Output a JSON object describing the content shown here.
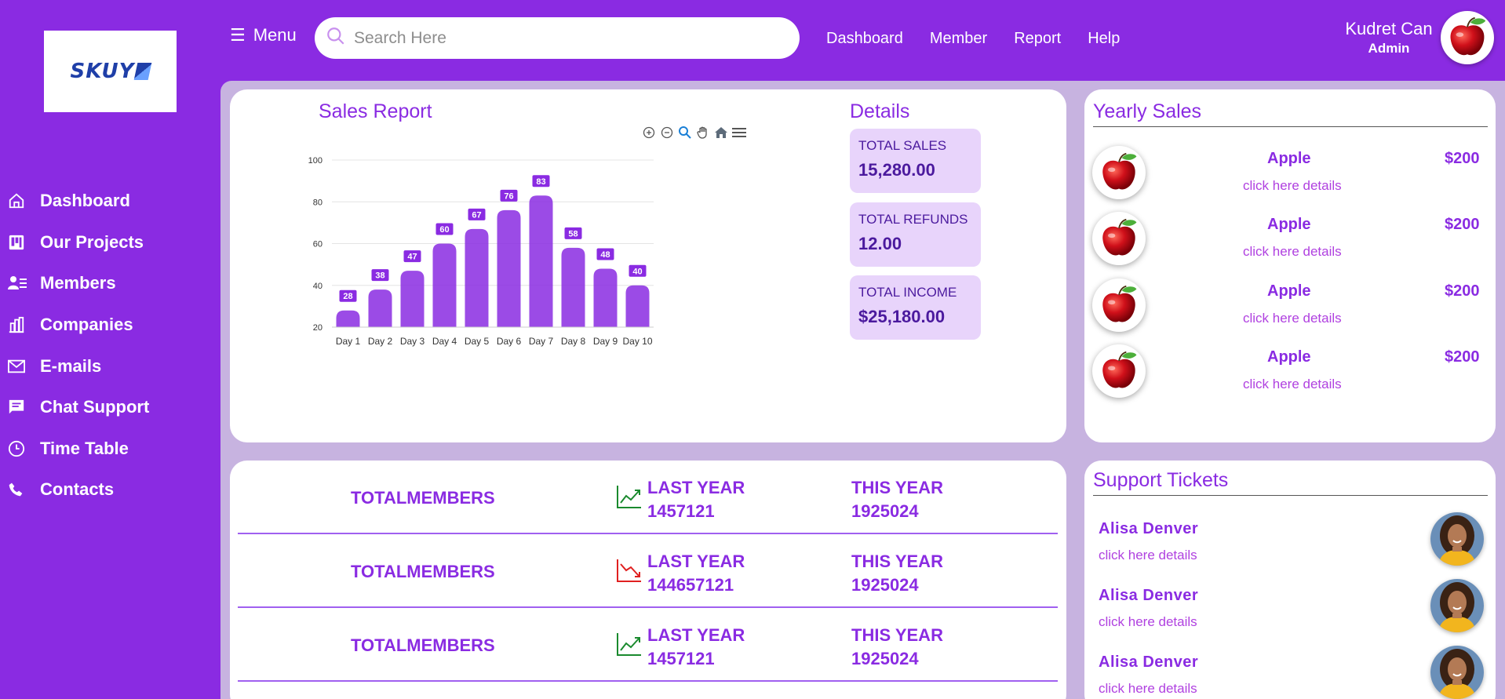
{
  "logo": {
    "text": "SKUY"
  },
  "sidebar": {
    "items": [
      {
        "label": "Dashboard",
        "icon": "home-icon"
      },
      {
        "label": "Our Projects",
        "icon": "projects-icon"
      },
      {
        "label": "Members",
        "icon": "members-icon"
      },
      {
        "label": "Companies",
        "icon": "companies-icon"
      },
      {
        "label": "E-mails",
        "icon": "mail-icon"
      },
      {
        "label": "Chat Support",
        "icon": "chat-icon"
      },
      {
        "label": "Time Table",
        "icon": "clock-icon"
      },
      {
        "label": "Contacts",
        "icon": "phone-icon"
      }
    ]
  },
  "header": {
    "menu_label": "Menu",
    "search_placeholder": "Search Here",
    "nav": [
      "Dashboard",
      "Member",
      "Report",
      "Help"
    ],
    "user": {
      "name": "Kudret Can",
      "role": "Admin"
    }
  },
  "sales_report": {
    "title": "Sales Report",
    "tools": [
      "zoom-in-icon",
      "zoom-out-icon",
      "zoom-selection-icon",
      "pan-hand-icon",
      "home-reset-icon",
      "menu-icon"
    ]
  },
  "chart_data": {
    "type": "bar",
    "categories": [
      "Day 1",
      "Day 2",
      "Day 3",
      "Day 4",
      "Day 5",
      "Day 6",
      "Day 7",
      "Day 8",
      "Day 9",
      "Day 10"
    ],
    "values": [
      28,
      38,
      47,
      60,
      67,
      76,
      83,
      58,
      48,
      40
    ],
    "yticks": [
      20,
      40,
      60,
      80,
      100
    ],
    "ylim": [
      20,
      100
    ],
    "grid": true,
    "bar_color": "#8a2be2"
  },
  "details": {
    "title": "Details",
    "items": [
      {
        "label": "TOTAL SALES",
        "value": "15,280.00"
      },
      {
        "label": "TOTAL REFUNDS",
        "value": "12.00"
      },
      {
        "label": "TOTAL INCOME",
        "value": "$25,180.00"
      }
    ]
  },
  "yearly_sales": {
    "title": "Yearly Sales",
    "items": [
      {
        "name": "Apple",
        "price": "$200",
        "link": "click here details"
      },
      {
        "name": "Apple",
        "price": "$200",
        "link": "click here details"
      },
      {
        "name": "Apple",
        "price": "$200",
        "link": "click here details"
      },
      {
        "name": "Apple",
        "price": "$200",
        "link": "click here details"
      }
    ]
  },
  "members": {
    "rows": [
      {
        "label": "TOTALMEMBERS",
        "trend": "up",
        "last_year_label": "LAST YEAR",
        "last_year": "1457121",
        "this_year_label": "THIS YEAR",
        "this_year": "1925024"
      },
      {
        "label": "TOTALMEMBERS",
        "trend": "down",
        "last_year_label": "LAST YEAR",
        "last_year": "144657121",
        "this_year_label": "THIS YEAR",
        "this_year": "1925024"
      },
      {
        "label": "TOTALMEMBERS",
        "trend": "up",
        "last_year_label": "LAST YEAR",
        "last_year": "1457121",
        "this_year_label": "THIS YEAR",
        "this_year": "1925024"
      }
    ]
  },
  "support_tickets": {
    "title": "Support Tickets",
    "items": [
      {
        "name": "Alisa Denver",
        "link": "click here details"
      },
      {
        "name": "Alisa Denver",
        "link": "click here details"
      },
      {
        "name": "Alisa Denver",
        "link": "click here details"
      }
    ]
  },
  "colors": {
    "brand": "#8a2be2",
    "panel": "#c7b3e0",
    "detail_box": "#e8d4fb",
    "trend_up": "#1a8a2e",
    "trend_down": "#e02020"
  }
}
